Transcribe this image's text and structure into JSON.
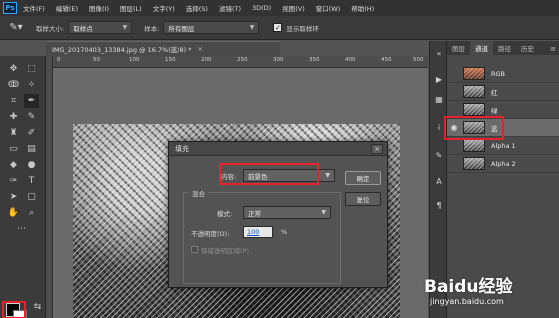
{
  "app": {
    "logo": "Ps"
  },
  "menubar": {
    "items": [
      "文件(F)",
      "编辑(E)",
      "图像(I)",
      "图层(L)",
      "文字(Y)",
      "选择(S)",
      "滤镜(T)",
      "3D(D)",
      "视图(V)",
      "窗口(W)",
      "帮助(H)"
    ]
  },
  "options_bar": {
    "sample_size_label": "取样大小:",
    "sample_size_value": "取样点",
    "sample_label": "样本:",
    "sample_value": "所有图层",
    "show_ring_label": "显示取样环",
    "show_ring_checked": true
  },
  "document": {
    "tab_title": "IMG_20170403_13384.jpg @ 16.7%(蓝/8) *",
    "close_glyph": "×"
  },
  "ruler": {
    "ticks": [
      "0",
      "50",
      "100",
      "150",
      "200",
      "250",
      "300",
      "350",
      "400",
      "450",
      "500"
    ]
  },
  "fill_dialog": {
    "title": "填充",
    "close_glyph": "×",
    "contents_label": "内容:",
    "contents_value": "前景色",
    "blending_group_label": "混合",
    "mode_label": "模式:",
    "mode_value": "正常",
    "opacity_label": "不透明度(O):",
    "opacity_value": "100",
    "opacity_unit": "%",
    "preserve_transparency_label": "保留透明区域(P)",
    "ok_label": "确定",
    "cancel_label": "复位"
  },
  "panel": {
    "tabs": [
      "图层",
      "通道",
      "路径",
      "历史"
    ],
    "active_tab_index": 1,
    "menu_glyph": "≡",
    "channels": [
      {
        "name": "RGB",
        "thumb": "rgb",
        "visible": false,
        "selected": false
      },
      {
        "name": "红",
        "thumb": "gray",
        "visible": false,
        "selected": false
      },
      {
        "name": "绿",
        "thumb": "gray",
        "visible": false,
        "selected": false
      },
      {
        "name": "蓝",
        "thumb": "gray",
        "visible": true,
        "selected": true
      },
      {
        "name": "Alpha 1",
        "thumb": "gray",
        "visible": false,
        "selected": false
      },
      {
        "name": "Alpha 2",
        "thumb": "gray",
        "visible": false,
        "selected": false
      }
    ]
  },
  "colors": {
    "highlight_red": "#e8222a",
    "foreground": "#000000",
    "background": "#ffffff"
  },
  "watermark": {
    "logo_text": "Baidu经验",
    "sub_text": "jingyan.baidu.com"
  }
}
